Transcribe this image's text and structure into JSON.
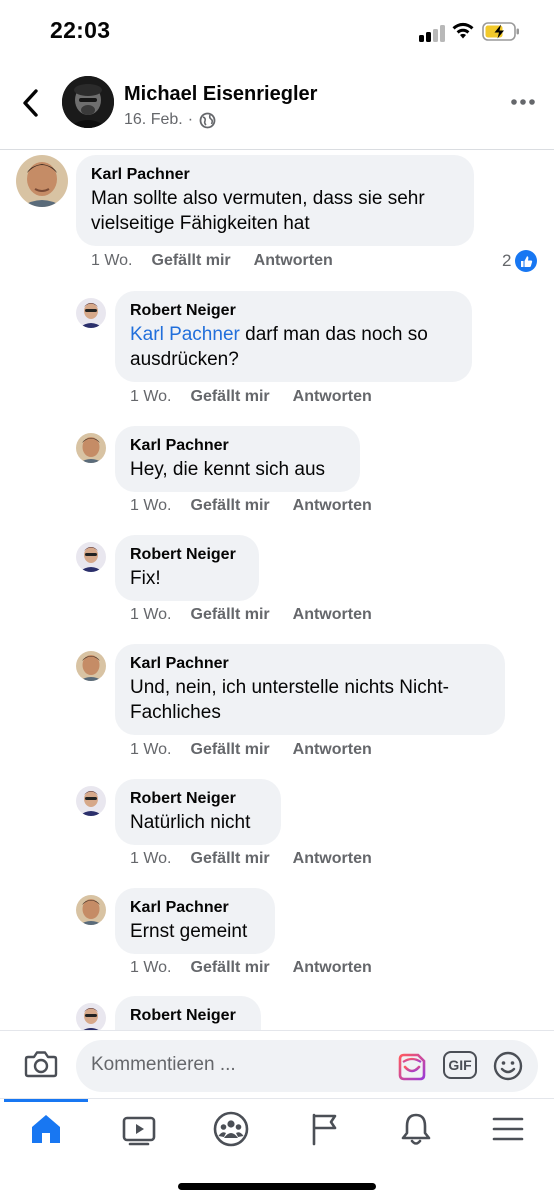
{
  "status_bar": {
    "time": "22:03"
  },
  "header": {
    "name": "Michael Eisenriegler",
    "date": "16. Feb.",
    "separator": "·"
  },
  "comments": [
    {
      "author": "Karl Pachner",
      "text": "Man sollte also vermuten, dass sie sehr vielseitige Fähigkeiten hat",
      "time": "1 Wo.",
      "like": "Gefällt mir",
      "reply": "Antworten",
      "reaction_count": "2"
    },
    {
      "author": "Robert Neiger",
      "mention": "Karl Pachner",
      "text": " darf man das noch so ausdrücken?",
      "time": "1 Wo.",
      "like": "Gefällt mir",
      "reply": "Antworten"
    },
    {
      "author": "Karl Pachner",
      "text": "Hey, die kennt sich aus",
      "time": "1 Wo.",
      "like": "Gefällt mir",
      "reply": "Antworten"
    },
    {
      "author": "Robert Neiger",
      "text": "Fix!",
      "time": "1 Wo.",
      "like": "Gefällt mir",
      "reply": "Antworten"
    },
    {
      "author": "Karl Pachner",
      "text": "Und, nein, ich unterstelle nichts Nicht-Fachliches",
      "time": "1 Wo.",
      "like": "Gefällt mir",
      "reply": "Antworten"
    },
    {
      "author": "Robert Neiger",
      "text": "Natürlich nicht",
      "time": "1 Wo.",
      "like": "Gefällt mir",
      "reply": "Antworten"
    },
    {
      "author": "Karl Pachner",
      "text": "Ernst gemeint",
      "time": "1 Wo.",
      "like": "Gefällt mir",
      "reply": "Antworten"
    },
    {
      "author": "Robert Neiger"
    }
  ],
  "composer": {
    "placeholder": "Kommentieren ...",
    "gif_label": "GIF"
  },
  "tabs": [
    {
      "icon": "home-icon",
      "active": true
    },
    {
      "icon": "video-icon"
    },
    {
      "icon": "groups-icon"
    },
    {
      "icon": "pages-flag-icon"
    },
    {
      "icon": "notifications-bell-icon"
    },
    {
      "icon": "menu-icon"
    }
  ],
  "colors": {
    "accent": "#1877f2",
    "mention": "#216fdb",
    "bubble": "#f0f2f5",
    "secondary_text": "#65676b"
  }
}
